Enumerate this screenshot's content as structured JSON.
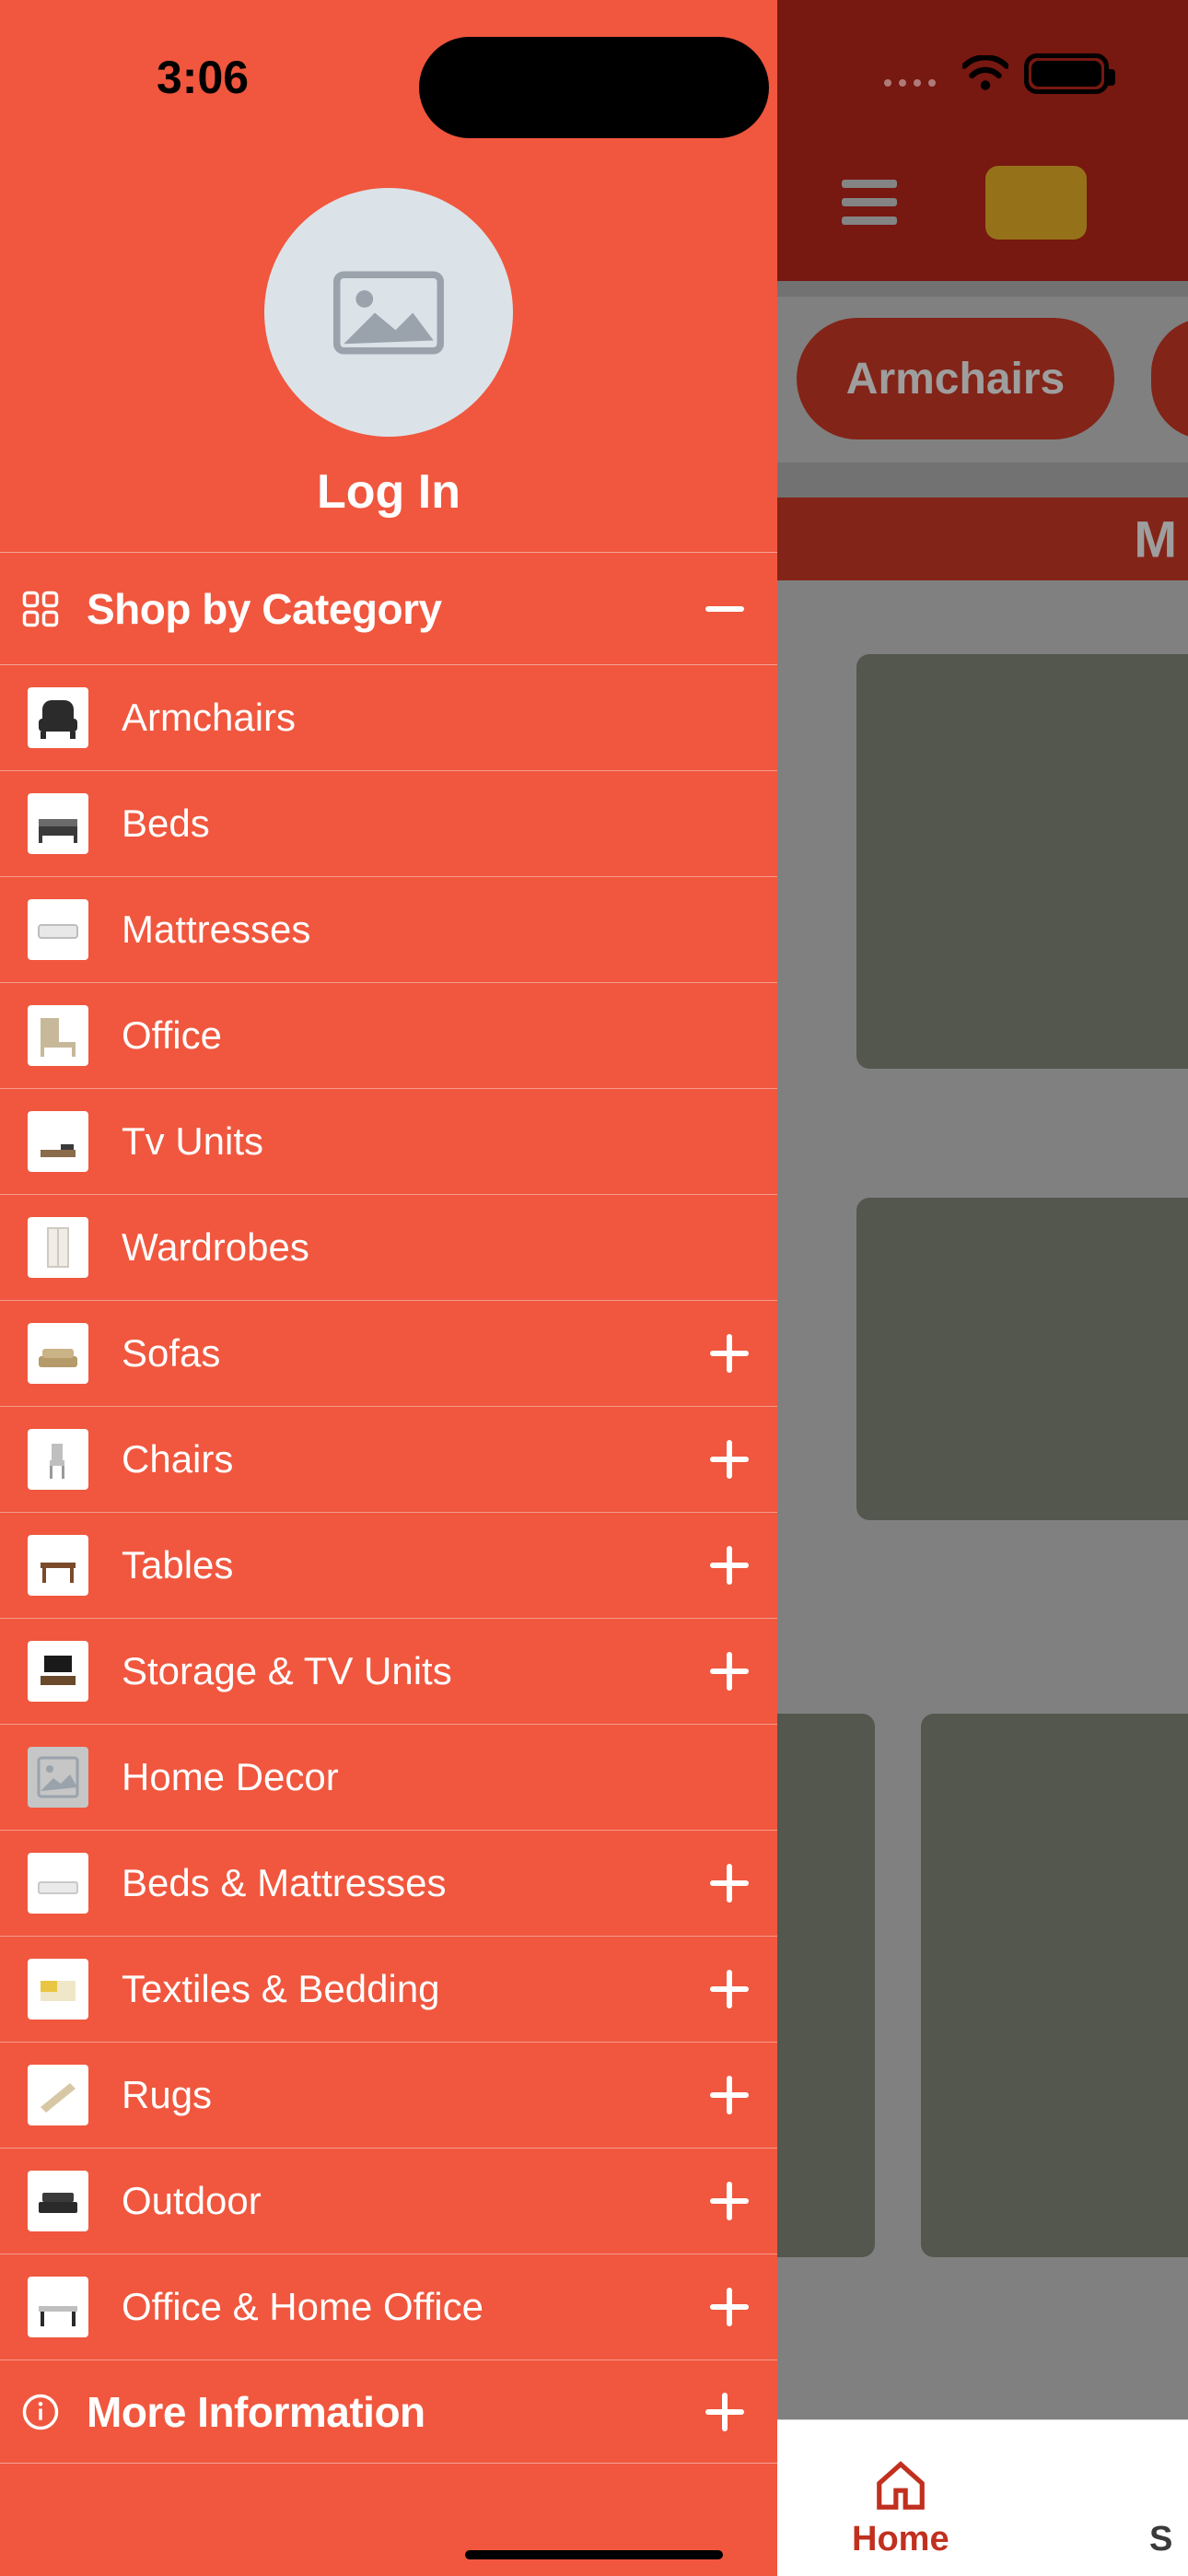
{
  "status": {
    "time": "3:06"
  },
  "drawer": {
    "login_label": "Log In",
    "section_title": "Shop by Category",
    "more_info_title": "More Information",
    "categories": [
      {
        "name": "Armchairs",
        "expandable": false
      },
      {
        "name": "Beds",
        "expandable": false
      },
      {
        "name": "Mattresses",
        "expandable": false
      },
      {
        "name": "Office",
        "expandable": false
      },
      {
        "name": "Tv Units",
        "expandable": false
      },
      {
        "name": "Wardrobes",
        "expandable": false
      },
      {
        "name": "Sofas",
        "expandable": true
      },
      {
        "name": "Chairs",
        "expandable": true
      },
      {
        "name": "Tables",
        "expandable": true
      },
      {
        "name": "Storage & TV Units",
        "expandable": true
      },
      {
        "name": "Home Decor",
        "expandable": false
      },
      {
        "name": "Beds & Mattresses",
        "expandable": true
      },
      {
        "name": "Textiles & Bedding",
        "expandable": true
      },
      {
        "name": "Rugs",
        "expandable": true
      },
      {
        "name": "Outdoor",
        "expandable": true
      },
      {
        "name": "Office & Home Office",
        "expandable": true
      }
    ]
  },
  "back": {
    "chip_label": "Armchairs",
    "banner_partial": "M"
  },
  "nav": {
    "home_label": "Home",
    "second_partial": "S"
  }
}
